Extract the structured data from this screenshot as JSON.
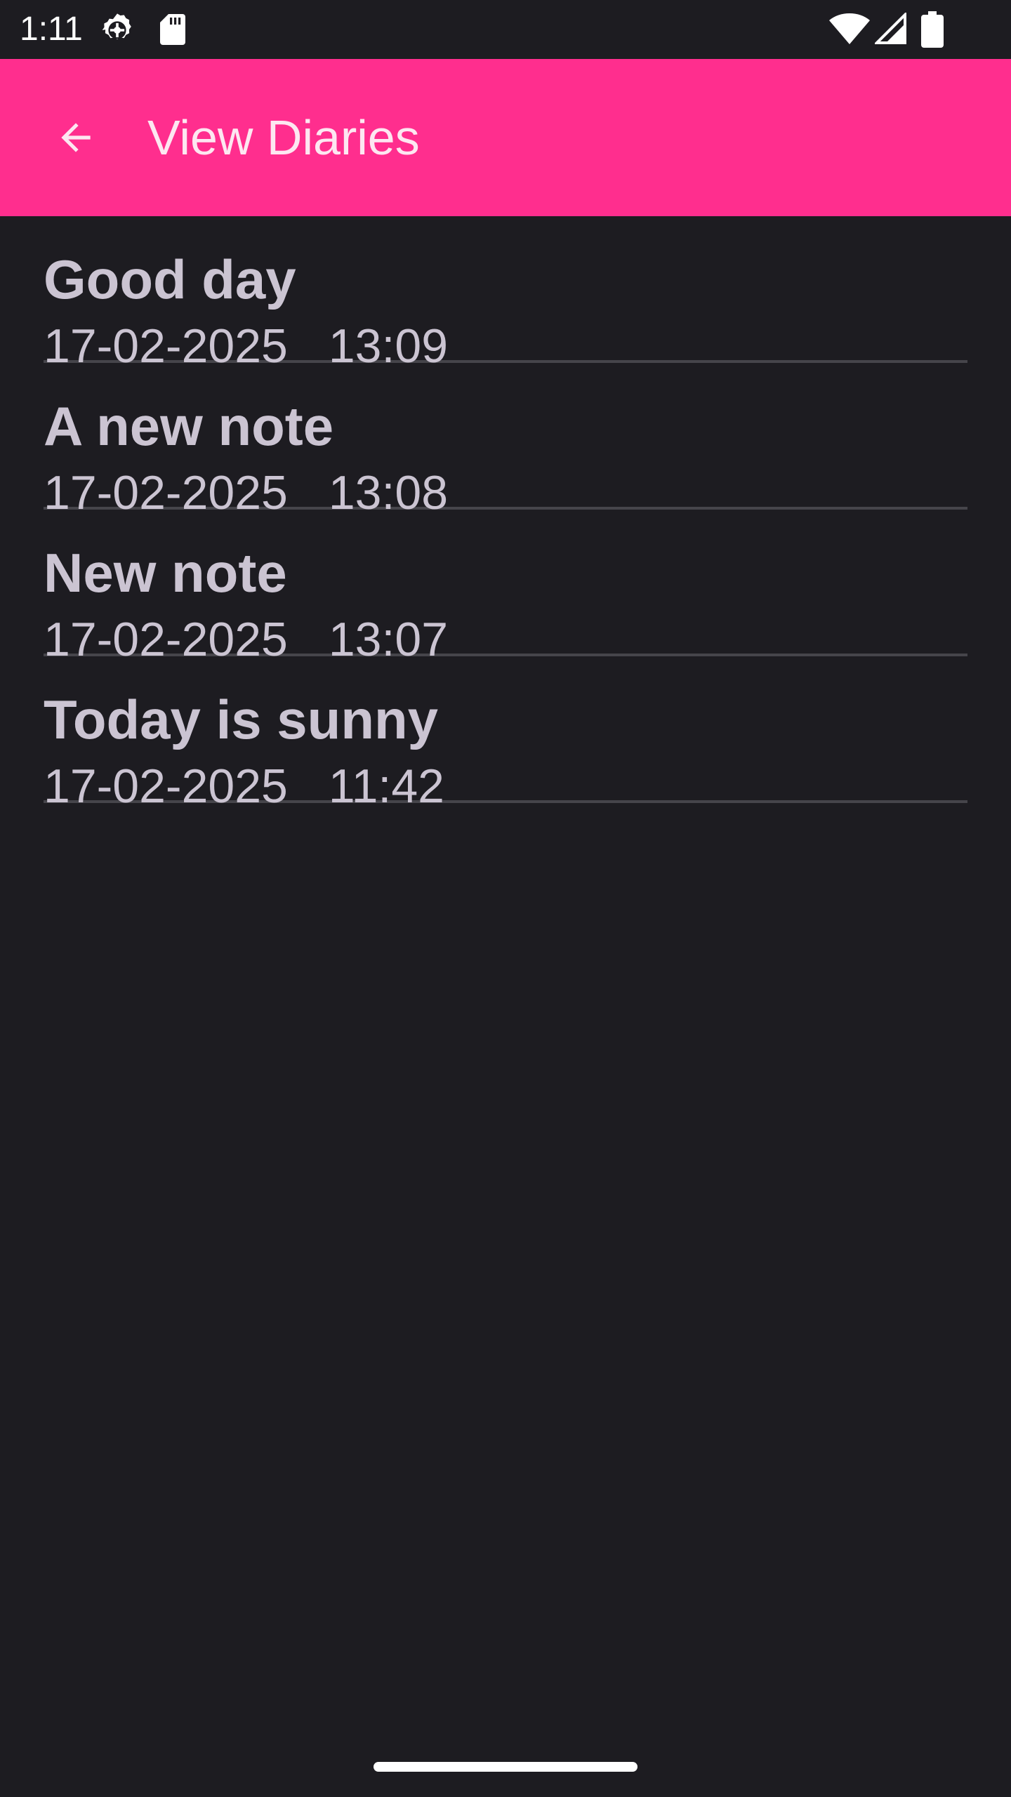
{
  "status_bar": {
    "time": "1:11",
    "icons": [
      "gear-icon",
      "sd-card-icon",
      "wifi-icon",
      "cell-signal-icon",
      "battery-icon"
    ]
  },
  "app_bar": {
    "back_icon": "arrow-back-icon",
    "title": "View Diaries",
    "background_color": "#ff2e8e",
    "title_color": "#fde7f1"
  },
  "diaries": [
    {
      "title": "Good day",
      "date": "17-02-2025",
      "time": "13:09"
    },
    {
      "title": "A new note",
      "date": "17-02-2025",
      "time": "13:08"
    },
    {
      "title": "New note",
      "date": "17-02-2025",
      "time": "13:07"
    },
    {
      "title": "Today is sunny",
      "date": "17-02-2025",
      "time": "11:42"
    }
  ],
  "colors": {
    "background": "#1d1c21",
    "text": "#cbc4d2",
    "divider": "#46454b"
  }
}
